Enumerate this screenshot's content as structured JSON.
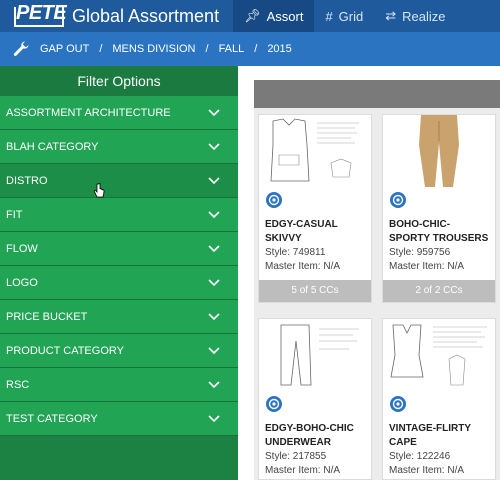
{
  "header": {
    "logo_text": "PETE",
    "app_title": "Global Assortment",
    "nav": [
      {
        "label": "Assort",
        "icon": "pin-icon"
      },
      {
        "label": "Grid",
        "icon": "hash-icon"
      },
      {
        "label": "Realize",
        "icon": "swap-icon"
      }
    ]
  },
  "breadcrumb": {
    "items": [
      "GAP OUT",
      "MENS DIVISION",
      "FALL",
      "2015"
    ],
    "separator": "/"
  },
  "sidebar": {
    "title": "Filter Options",
    "items": [
      {
        "label": "ASSORTMENT ARCHITECTURE"
      },
      {
        "label": "BLAH CATEGORY"
      },
      {
        "label": "DISTRO"
      },
      {
        "label": "FIT"
      },
      {
        "label": "FLOW"
      },
      {
        "label": "LOGO"
      },
      {
        "label": "PRICE BUCKET"
      },
      {
        "label": "PRODUCT CATEGORY"
      },
      {
        "label": "RSC"
      },
      {
        "label": "TEST CATEGORY"
      }
    ]
  },
  "products": [
    {
      "name": "EDGY-CASUAL SKIVVY",
      "style": "Style: 749811",
      "master": "Master Item: N/A",
      "ccs": "5 of 5 CCs"
    },
    {
      "name": "BOHO-CHIC-SPORTY TROUSERS",
      "style": "Style: 959756",
      "master": "Master Item: N/A",
      "ccs": "2 of 2 CCs"
    },
    {
      "name": "EDGY-BOHO-CHIC UNDERWEAR",
      "style": "Style: 217855",
      "master": "Master Item: N/A",
      "ccs": ""
    },
    {
      "name": "VINTAGE-FLIRTY CAPE",
      "style": "Style: 122246",
      "master": "Master Item: N/A",
      "ccs": ""
    }
  ],
  "colors": {
    "topbar": "#1e5a9c",
    "breadcrumb": "#2b74c1",
    "sidebar": "#22a455",
    "sidebar_dark": "#1b8244"
  }
}
